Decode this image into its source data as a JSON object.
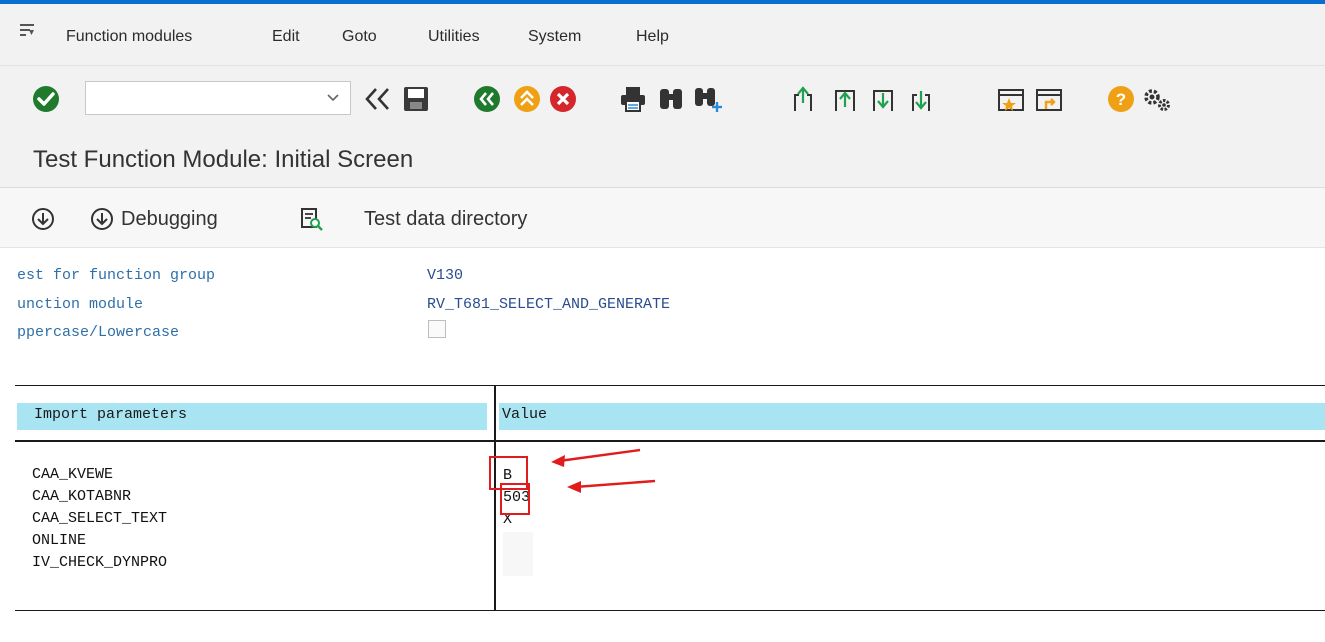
{
  "menubar": {
    "items": [
      "Function modules",
      "Edit",
      "Goto",
      "Utilities",
      "System",
      "Help"
    ]
  },
  "toolbar": {
    "command_field_value": "",
    "icons": [
      "enter-icon",
      "collapse-icon",
      "save-icon",
      "back-icon",
      "exit-icon",
      "cancel-icon",
      "print-icon",
      "find-icon",
      "find-next-icon",
      "first-page-icon",
      "previous-page-icon",
      "next-page-icon",
      "last-page-icon",
      "create-session-icon",
      "shortcut-icon",
      "help-icon",
      "settings-icon"
    ]
  },
  "title": "Test Function Module: Initial Screen",
  "app_toolbar": {
    "execute_label": "",
    "debugging_label": "Debugging",
    "test_data_label": "Test data directory"
  },
  "header_fields": {
    "group_label": "est for function group",
    "group_value": "V130",
    "module_label": "unction module",
    "module_value": "RV_T681_SELECT_AND_GENERATE",
    "case_label": "ppercase/Lowercase",
    "case_checked": false
  },
  "params": {
    "col_param": "Import parameters",
    "col_value": "Value",
    "rows": [
      {
        "name": "CAA_KVEWE",
        "value": "B"
      },
      {
        "name": "CAA_KOTABNR",
        "value": "503"
      },
      {
        "name": "CAA_SELECT_TEXT",
        "value": "X"
      },
      {
        "name": "ONLINE",
        "value": ""
      },
      {
        "name": "IV_CHECK_DYNPRO",
        "value": ""
      }
    ]
  },
  "colors": {
    "accent": "#0a6ed1",
    "header_bg": "#a9e4f2",
    "label_blue": "#2f6fa8",
    "annotation_red": "#e21c1c"
  }
}
